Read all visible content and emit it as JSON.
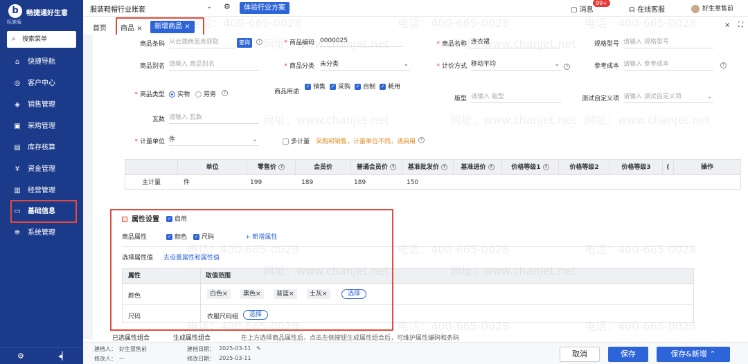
{
  "sidebar": {
    "logo_mark": "b",
    "logo_name": "畅捷通好生意",
    "logo_edition": "标准版",
    "search_label": "搜索菜单",
    "items": [
      {
        "label": "快捷导航",
        "icon": "house-icon"
      },
      {
        "label": "客户中心",
        "icon": "location-icon"
      },
      {
        "label": "销售管理",
        "icon": "sales-icon"
      },
      {
        "label": "采购管理",
        "icon": "cart-icon"
      },
      {
        "label": "库存核算",
        "icon": "inventory-icon"
      },
      {
        "label": "资金管理",
        "icon": "money-icon"
      },
      {
        "label": "经营管理",
        "icon": "report-icon"
      },
      {
        "label": "基础信息",
        "icon": "info-card-icon"
      },
      {
        "label": "系统管理",
        "icon": "system-icon"
      }
    ],
    "active_item": "基础信息"
  },
  "topbar": {
    "account": "服装鞋帽行业账套",
    "experience_button": "体验行业方案",
    "messages_label": "消息",
    "messages_badge": "99+",
    "service_label": "在线客服",
    "user_name": "好生意售前"
  },
  "tabs": {
    "home": "首页",
    "goods": "商品",
    "new_goods": "新增商品"
  },
  "form": {
    "barcode": {
      "label": "商品条码",
      "placeholder": "从云端商品库获取",
      "button": "查询"
    },
    "code": {
      "label": "商品编码",
      "value": "0000025"
    },
    "name": {
      "label": "商品名称",
      "value": "连衣裙"
    },
    "spec": {
      "label": "规格型号",
      "placeholder": "请输入 规格型号"
    },
    "alias": {
      "label": "商品别名",
      "placeholder": "请输入 商品别名"
    },
    "category": {
      "label": "商品分类",
      "value": "未分类"
    },
    "pricing": {
      "label": "计价方式",
      "value": "移动平均"
    },
    "ref_cost": {
      "label": "参考成本",
      "placeholder": "请输入 参考成本"
    },
    "type": {
      "label": "商品类型",
      "options": [
        "实物",
        "劳务"
      ],
      "selected": "实物"
    },
    "usage": {
      "label": "商品用途",
      "options": [
        "销售",
        "采购",
        "自制",
        "耗用"
      ]
    },
    "format": {
      "label": "版型",
      "placeholder": "请输入 版型"
    },
    "custom": {
      "label": "测试自定义项",
      "placeholder": "请输入 测试自定义项"
    },
    "tile": {
      "label": "瓦数",
      "placeholder": "请输入 瓦数"
    },
    "unit": {
      "label": "计量单位",
      "value": "件"
    },
    "multi_unit": {
      "label": "多计量",
      "hint": "采购和销售，计量单位不同，请启用"
    }
  },
  "price_table": {
    "headers": [
      "单位",
      "零售价",
      "会员价",
      "普通会员价",
      "基准批发价",
      "基准进价",
      "价格等级1",
      "价格等级2",
      "价格等级3",
      "(",
      "操作"
    ],
    "row": {
      "label": "主计量",
      "unit": "件",
      "retail": "199",
      "member": "189",
      "normal_member": "189",
      "wholesale": "150"
    }
  },
  "attributes": {
    "title": "属性设置",
    "enable_label": "启用",
    "goods_attr_label": "商品属性",
    "attr_options": [
      "颜色",
      "尺码"
    ],
    "add_attr": "+ 新增属性",
    "select_values_label": "选择属性值",
    "go_setup_link": "去设置属性和属性值",
    "table_headers": [
      "属性",
      "取值范围"
    ],
    "rows": [
      {
        "name": "颜色",
        "values": [
          "白色",
          "黑色",
          "普蓝",
          "土灰"
        ],
        "button": "选择"
      },
      {
        "name": "尺码",
        "values": [
          "衣服尺码组"
        ],
        "button": "选择"
      }
    ]
  },
  "combo": {
    "selected_tab": "已选属性组合",
    "generate_tab": "生成属性组合",
    "hint": "在上方选择商品属性后，点击左侧按钮生成属性组合后，可维护属性编码和条码"
  },
  "footer": {
    "creator_label": "建档人：",
    "creator": "好生意售前",
    "modifier_label": "修改人：",
    "modifier": "—",
    "create_date_label": "建档日期：",
    "create_date": "2025-03-11",
    "modify_date_label": "修改日期：",
    "modify_date": "2025-03-11",
    "cancel": "取消",
    "save": "保存",
    "save_new": "保存&新增"
  },
  "watermark": {
    "phone": "电话：400-665-0028",
    "site": "网址：www.chanjet.net"
  },
  "colors": {
    "sidebar": "#1b3a8a",
    "primary": "#2d64d8",
    "highlight": "#e24b3c"
  }
}
